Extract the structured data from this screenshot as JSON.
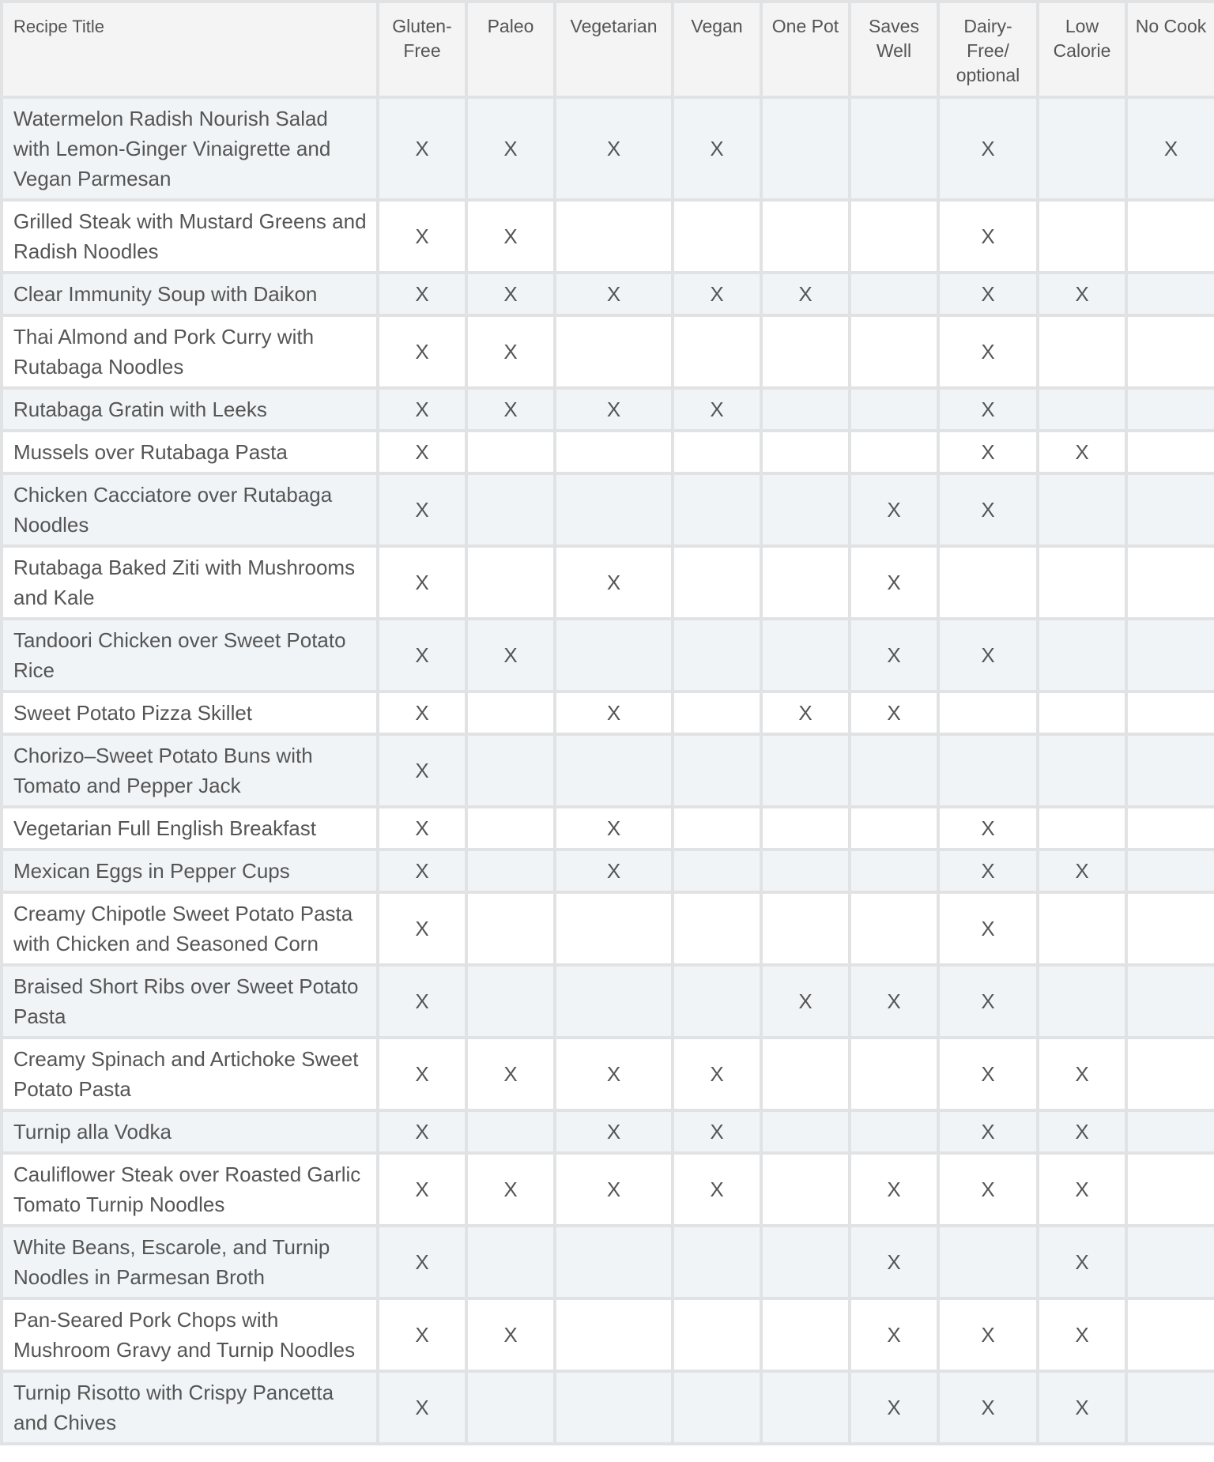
{
  "table": {
    "columns": [
      "Recipe Title",
      "Gluten-Free",
      "Paleo",
      "Vegetarian",
      "Vegan",
      "One Pot",
      "Saves Well",
      "Dairy-Free/ optional",
      "Low Calorie",
      "No Cook"
    ],
    "mark_symbol": "X",
    "rows": [
      {
        "title": "Watermelon Radish Nourish Salad with Lemon-Ginger Vinaigrette and Vegan Parmesan",
        "cells": [
          "X",
          "X",
          "X",
          "X",
          "",
          "",
          "X",
          "",
          "X"
        ]
      },
      {
        "title": "Grilled Steak with Mustard Greens and Radish Noodles",
        "cells": [
          "X",
          "X",
          "",
          "",
          "",
          "",
          "X",
          "",
          ""
        ]
      },
      {
        "title": "Clear Immunity Soup with Daikon",
        "cells": [
          "X",
          "X",
          "X",
          "X",
          "X",
          "",
          "X",
          "X",
          ""
        ]
      },
      {
        "title": "Thai Almond and Pork Curry with Rutabaga Noodles",
        "cells": [
          "X",
          "X",
          "",
          "",
          "",
          "",
          "X",
          "",
          ""
        ]
      },
      {
        "title": "Rutabaga Gratin with Leeks",
        "cells": [
          "X",
          "X",
          "X",
          "X",
          "",
          "",
          "X",
          "",
          ""
        ]
      },
      {
        "title": "Mussels over Rutabaga Pasta",
        "cells": [
          "X",
          "",
          "",
          "",
          "",
          "",
          "X",
          "X",
          ""
        ]
      },
      {
        "title": "Chicken Cacciatore over Rutabaga Noodles",
        "cells": [
          "X",
          "",
          "",
          "",
          "",
          "X",
          "X",
          "",
          ""
        ]
      },
      {
        "title": "Rutabaga Baked Ziti with Mushrooms and Kale",
        "cells": [
          "X",
          "",
          "X",
          "",
          "",
          "X",
          "",
          "",
          ""
        ]
      },
      {
        "title": "Tandoori Chicken over Sweet Potato Rice",
        "cells": [
          "X",
          "X",
          "",
          "",
          "",
          "X",
          "X",
          "",
          ""
        ]
      },
      {
        "title": "Sweet Potato Pizza Skillet",
        "cells": [
          "X",
          "",
          "X",
          "",
          "X",
          "X",
          "",
          "",
          ""
        ]
      },
      {
        "title": "Chorizo–Sweet Potato Buns with Tomato and Pepper Jack",
        "cells": [
          "X",
          "",
          "",
          "",
          "",
          "",
          "",
          "",
          ""
        ]
      },
      {
        "title": "Vegetarian Full English Breakfast",
        "cells": [
          "X",
          "",
          "X",
          "",
          "",
          "",
          "X",
          "",
          ""
        ]
      },
      {
        "title": "Mexican Eggs in Pepper Cups",
        "cells": [
          "X",
          "",
          "X",
          "",
          "",
          "",
          "X",
          "X",
          ""
        ]
      },
      {
        "title": "Creamy Chipotle Sweet Potato Pasta with Chicken and Seasoned Corn",
        "cells": [
          "X",
          "",
          "",
          "",
          "",
          "",
          "X",
          "",
          ""
        ]
      },
      {
        "title": "Braised Short Ribs over Sweet Potato Pasta",
        "cells": [
          "X",
          "",
          "",
          "",
          "X",
          "X",
          "X",
          "",
          ""
        ]
      },
      {
        "title": "Creamy Spinach and Artichoke Sweet Potato Pasta",
        "cells": [
          "X",
          "X",
          "X",
          "X",
          "",
          "",
          "X",
          "X",
          ""
        ]
      },
      {
        "title": "Turnip alla Vodka",
        "cells": [
          "X",
          "",
          "X",
          "X",
          "",
          "",
          "X",
          "X",
          ""
        ]
      },
      {
        "title": "Cauliflower Steak over Roasted Garlic Tomato Turnip Noodles",
        "cells": [
          "X",
          "X",
          "X",
          "X",
          "",
          "X",
          "X",
          "X",
          ""
        ]
      },
      {
        "title": "White Beans, Escarole, and Turnip Noodles in Parmesan Broth",
        "cells": [
          "X",
          "",
          "",
          "",
          "",
          "X",
          "",
          "X",
          ""
        ]
      },
      {
        "title": "Pan-Seared Pork Chops with Mushroom Gravy and Turnip Noodles",
        "cells": [
          "X",
          "X",
          "",
          "",
          "",
          "X",
          "X",
          "X",
          ""
        ]
      },
      {
        "title": "Turnip Risotto with Crispy Pancetta and Chives",
        "cells": [
          "X",
          "",
          "",
          "",
          "",
          "X",
          "X",
          "X",
          ""
        ]
      }
    ]
  }
}
